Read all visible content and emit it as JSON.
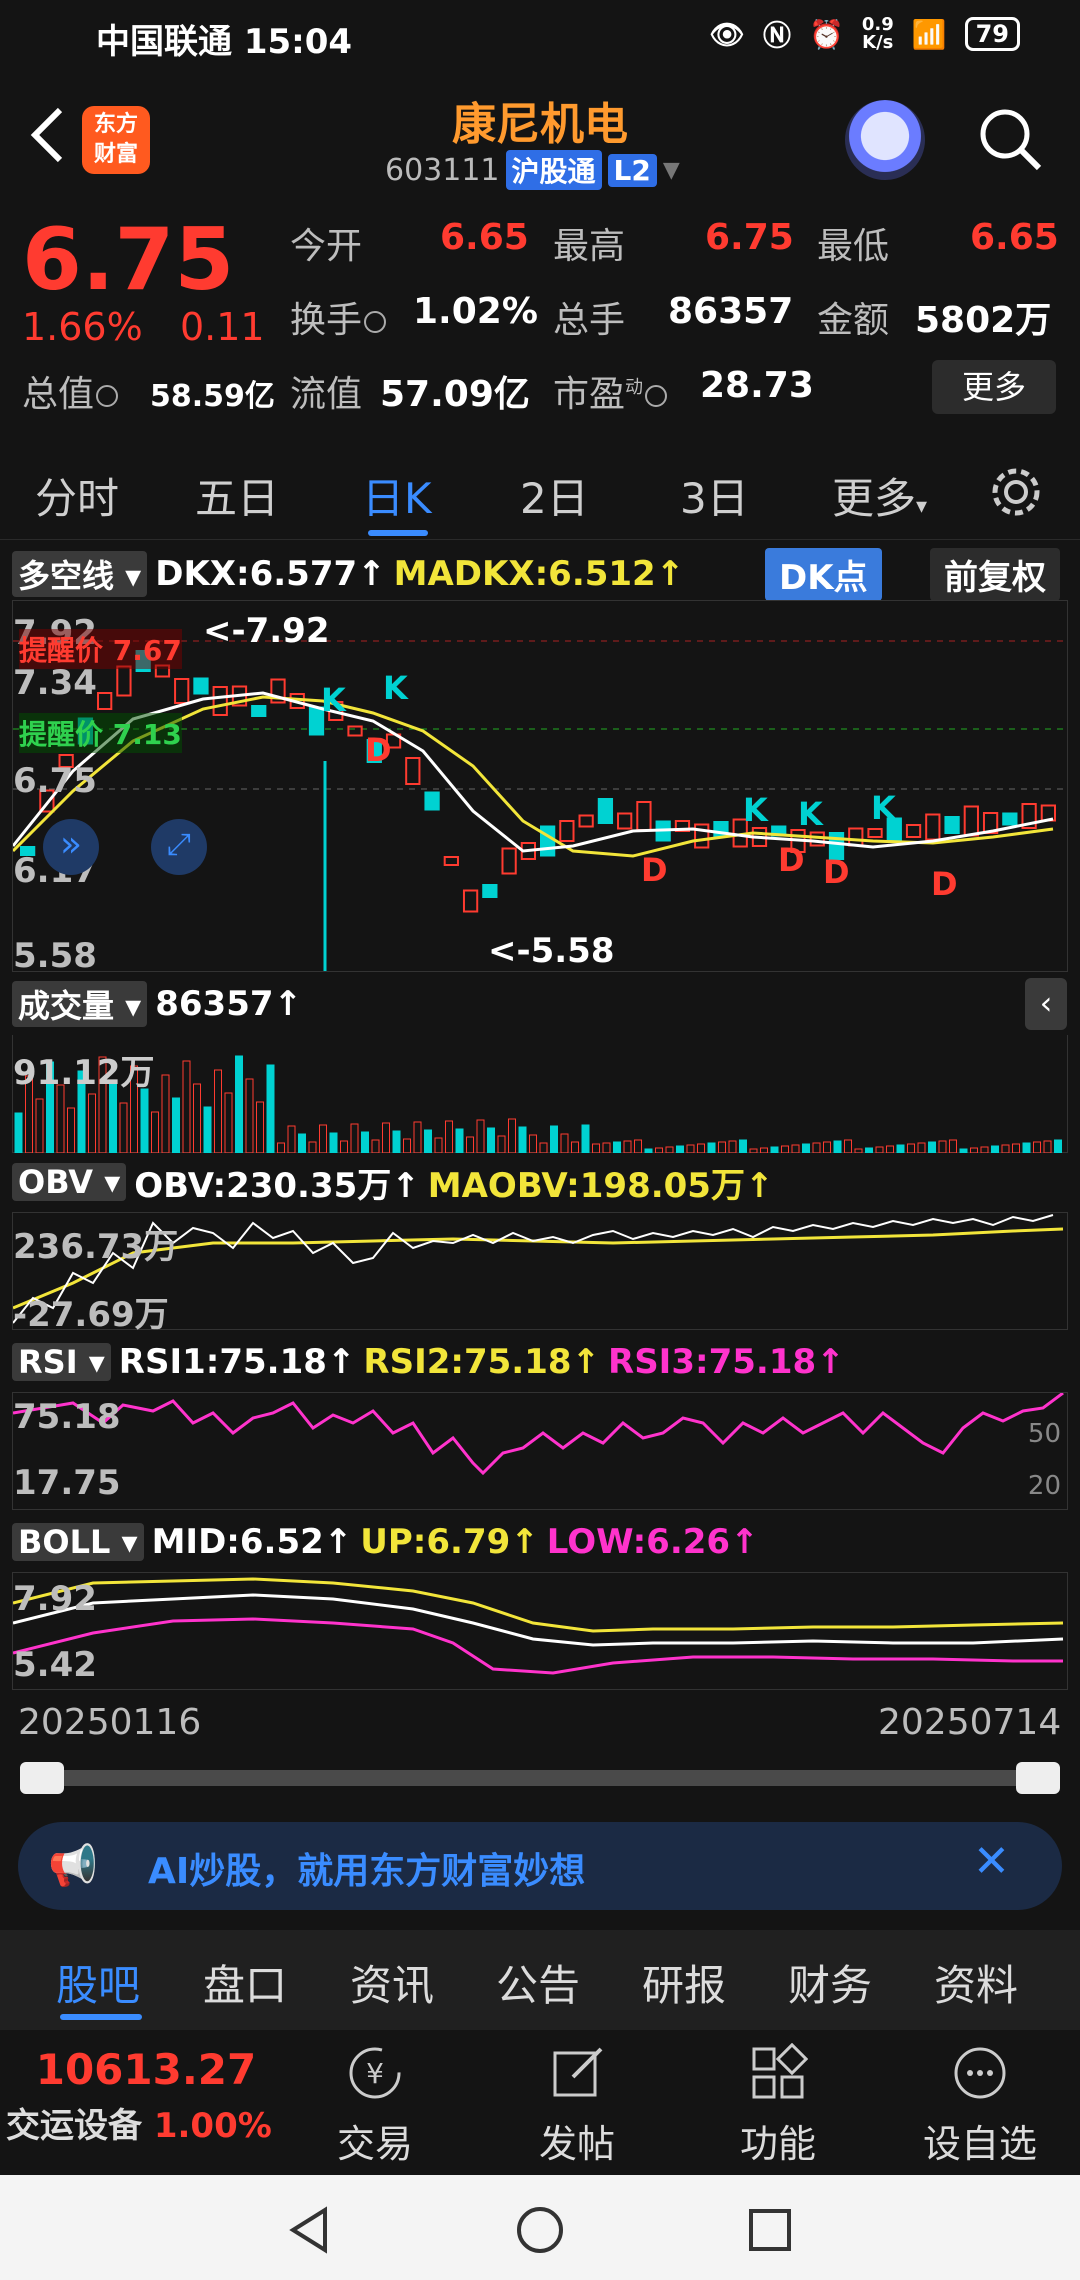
{
  "status_bar": {
    "carrier_time": "中国联通 15:04",
    "net_speed_top": "0.9",
    "net_speed_unit": "K/s",
    "battery": "79"
  },
  "header": {
    "logo_text_1": "东方",
    "logo_text_2": "财富",
    "stock_name": "康尼机电",
    "stock_code": "603111",
    "tag1": "沪股通",
    "tag2": "L2"
  },
  "quote": {
    "price": "6.75",
    "change_pct": "1.66%",
    "change_amt": "0.11",
    "open_label": "今开",
    "open": "6.65",
    "high_label": "最高",
    "high": "6.75",
    "low_label": "最低",
    "low": "6.65",
    "turnover_label": "换手",
    "turnover": "1.02%",
    "volume_label": "总手",
    "volume": "86357",
    "amount_label": "金额",
    "amount": "5802万",
    "mktcap_label": "总值",
    "mktcap": "58.59亿",
    "float_label": "流值",
    "float": "57.09亿",
    "pe_label": "市盈",
    "pe_sup": "动",
    "pe": "28.73",
    "more": "更多"
  },
  "tabs": [
    "分时",
    "五日",
    "日K",
    "2日",
    "3日",
    "更多"
  ],
  "active_tab": "日K",
  "kline": {
    "indicator": "多空线",
    "dkx": "DKX:6.577↑",
    "madkx": "MADKX:6.512↑",
    "dk_button": "DK点",
    "adjust_button": "前复权",
    "y_ticks": [
      "7.92",
      "7.34",
      "6.75",
      "6.17",
      "5.58"
    ],
    "alert_red": "提醒价 7.67",
    "alert_green": "提醒价 7.13",
    "max_label": "<-7.92",
    "min_label": "<-5.58"
  },
  "volume": {
    "indicator": "成交量",
    "value": "86357↑",
    "y_tick": "91.12万"
  },
  "obv": {
    "indicator": "OBV",
    "obv": "OBV:230.35万↑",
    "maobv": "MAOBV:198.05万↑",
    "y_top": "236.73万",
    "y_bottom": "-27.69万"
  },
  "rsi": {
    "indicator": "RSI",
    "rsi1": "RSI1:75.18↑",
    "rsi2": "RSI2:75.18↑",
    "rsi3": "RSI3:75.18↑",
    "y_top": "75.18",
    "y_bottom": "17.75",
    "r50": "50",
    "r20": "20"
  },
  "boll": {
    "indicator": "BOLL",
    "mid": "MID:6.52↑",
    "up": "UP:6.79↑",
    "low": "LOW:6.26↑",
    "y_top": "7.92",
    "y_bottom": "5.42"
  },
  "dates": {
    "start": "20250116",
    "end": "20250714"
  },
  "banner": {
    "text": "AI炒股，就用东方财富妙想"
  },
  "info_tabs": [
    "股吧",
    "盘口",
    "资讯",
    "公告",
    "研报",
    "财务",
    "资料"
  ],
  "toolbar": {
    "index_value": "10613.27",
    "index_name": "交运设备",
    "index_pct": "1.00%",
    "trade": "交易",
    "post": "发帖",
    "function": "功能",
    "watchlist": "设自选"
  },
  "colors": {
    "up": "#ff3b30",
    "down": "#00d2d2",
    "accent": "#3a8cff",
    "yellow": "#f2e53a",
    "magenta": "#ff33cc"
  }
}
